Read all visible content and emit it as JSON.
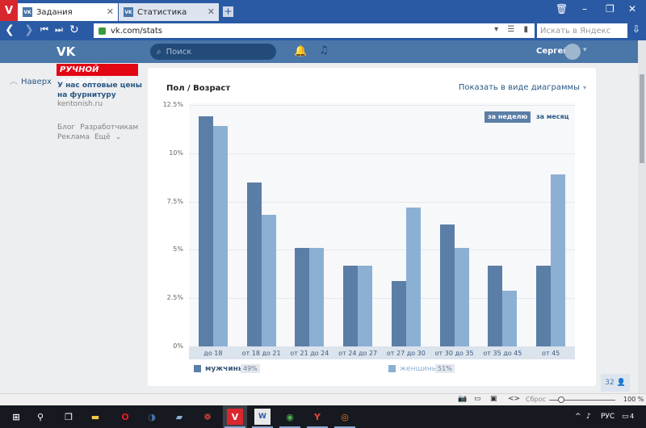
{
  "browser": {
    "brand_letter": "V",
    "tabs": [
      {
        "label": "Задания",
        "favicon": "VK"
      },
      {
        "label": "Статистика",
        "favicon": "VK"
      }
    ],
    "new_tab": "+",
    "url": "vk.com/stats",
    "search_placeholder": "Искать в Яндекс",
    "zoom_reset_label": "Сброс",
    "zoom_level": "100 %"
  },
  "vk_header": {
    "logo": "VK",
    "search_placeholder": "Поиск",
    "username": "Сергей"
  },
  "sidebar": {
    "back_label": "Наверх",
    "ad_banner": "РУЧНОЙ РАБОТЫ ?",
    "ad_title": "У нас оптовые цены на фурнитуру",
    "ad_domain": "kentonish.ru",
    "footer_links": [
      "Блог",
      "Разработчикам",
      "Реклама",
      "Ещё"
    ]
  },
  "stats": {
    "title": "Пол / Возраст",
    "diagram_toggle": "Показать в виде диаграммы",
    "period_active": "за неделю",
    "period_other": "за месяц",
    "legend": [
      {
        "label": "мужчины",
        "pct": "49%",
        "color": "#5b7ea6"
      },
      {
        "label": "женщины",
        "pct": "51%",
        "color": "#8cb0d4"
      }
    ],
    "counter": "32"
  },
  "taskbar": {
    "language": "РУС",
    "notifications": "4"
  },
  "chart_data": {
    "type": "bar",
    "categories": [
      "до 18",
      "от 18 до 21",
      "от 21 до 24",
      "от 24 до 27",
      "от 27 до 30",
      "от 30 до 35",
      "от 35 до 45",
      "от 45"
    ],
    "series": [
      {
        "name": "мужчины",
        "values": [
          11.9,
          8.5,
          5.1,
          4.2,
          3.4,
          6.3,
          4.2,
          4.2
        ]
      },
      {
        "name": "женщины",
        "values": [
          11.4,
          6.8,
          5.1,
          4.2,
          7.2,
          5.1,
          2.9,
          8.9
        ]
      }
    ],
    "ylim": [
      0,
      12.5
    ],
    "yticks": [
      "0%",
      "2.5%",
      "5%",
      "7.5%",
      "10%",
      "12.5%"
    ],
    "ytick_values": [
      0,
      2.5,
      5,
      7.5,
      10,
      12.5
    ],
    "title": "Пол / Возраст",
    "xlabel": "",
    "ylabel": "",
    "colors": [
      "#5b7ea6",
      "#8cb0d4"
    ],
    "grid": true
  }
}
